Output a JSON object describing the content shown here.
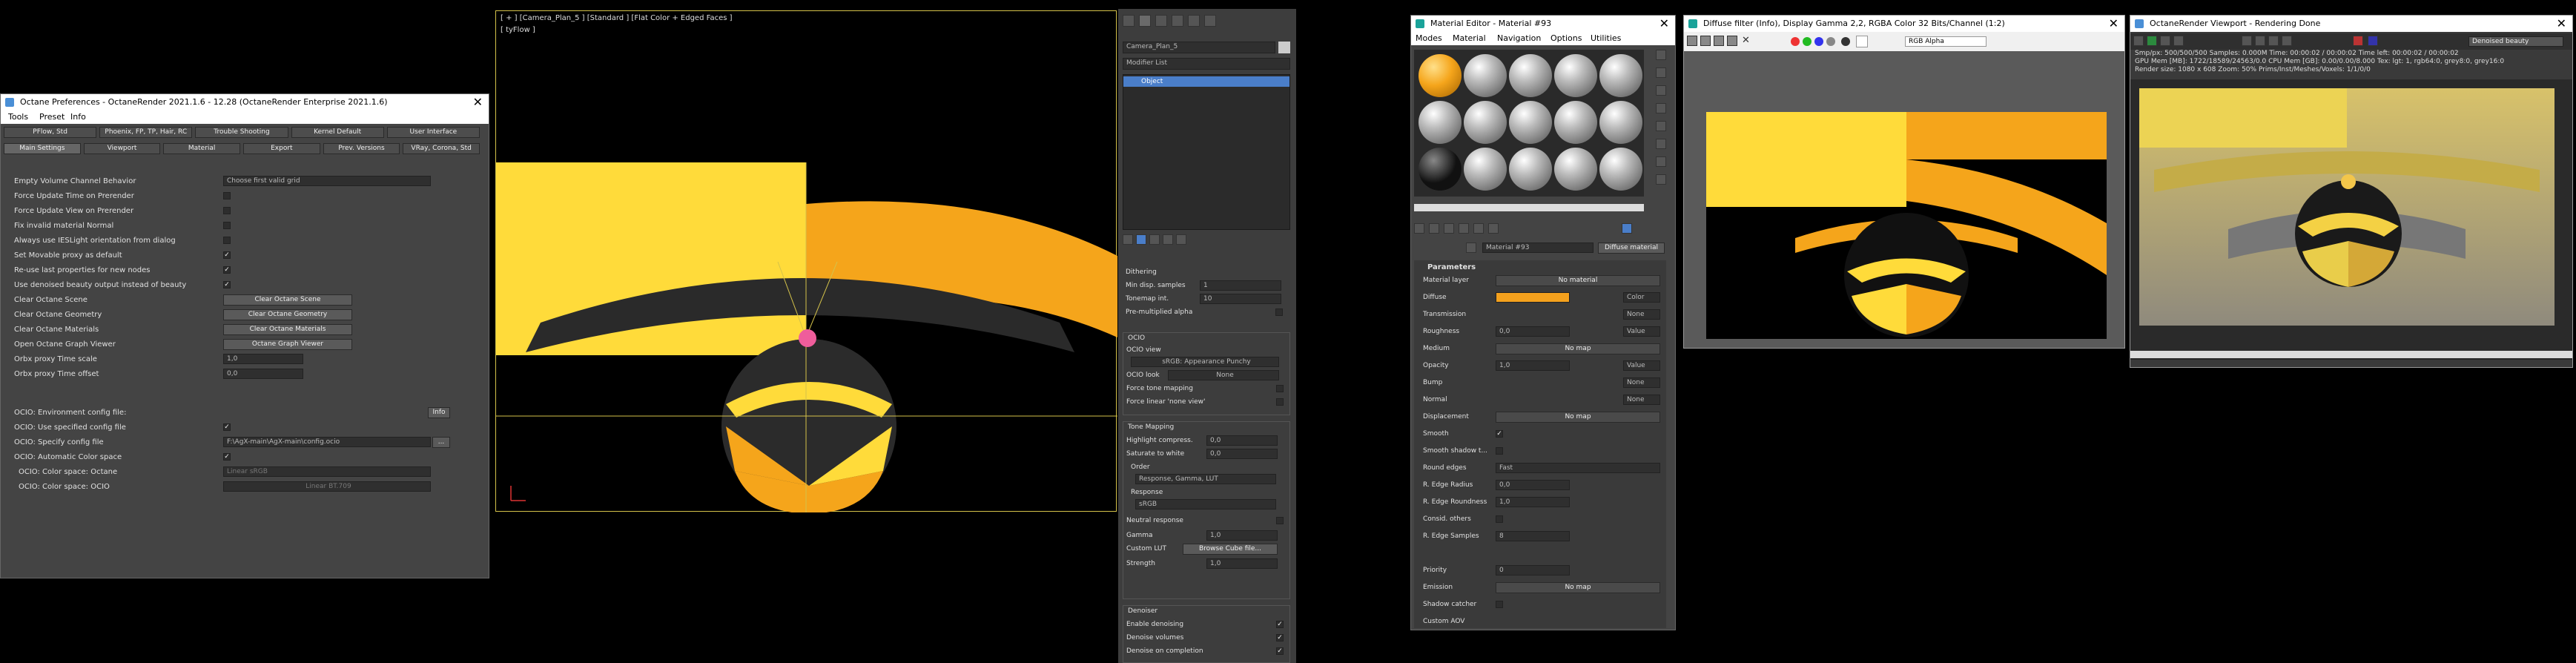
{
  "prefs": {
    "title": "Octane Preferences - OctaneRender 2021.1.6 - 12.28 (OctaneRender Enterprise 2021.1.6)",
    "menu": [
      "Tools",
      "Preset",
      "Info"
    ],
    "tabs_row1": [
      "PFlow, Std",
      "Phoenix, FP, TP, Hair, RC",
      "Trouble Shooting",
      "Kernel Default",
      "User Interface"
    ],
    "tabs_row2": [
      "Main Settings",
      "Viewport",
      "Material",
      "Export",
      "Prev. Versions",
      "VRay, Corona, Std"
    ],
    "rows": [
      {
        "label": "Empty Volume Channel Behavior",
        "kind": "select",
        "value": "Choose first valid grid"
      },
      {
        "label": "Force Update Time on Prerender",
        "kind": "check",
        "value": ""
      },
      {
        "label": "Force Update View on Prerender",
        "kind": "check",
        "value": ""
      },
      {
        "label": "Fix invalid material Normal",
        "kind": "check",
        "value": ""
      },
      {
        "label": "Always use IESLight orientation from dialog",
        "kind": "check",
        "value": ""
      },
      {
        "label": "Set Movable proxy as default",
        "kind": "check",
        "value": "✓"
      },
      {
        "label": "Re-use last properties for new nodes",
        "kind": "check",
        "value": "✓"
      },
      {
        "label": "Use denoised beauty output instead of beauty",
        "kind": "check",
        "value": "✓"
      },
      {
        "label": "Clear Octane Scene",
        "kind": "button",
        "value": "Clear Octane Scene"
      },
      {
        "label": "Clear Octane Geometry",
        "kind": "button",
        "value": "Clear Octane Geometry"
      },
      {
        "label": "Clear Octane Materials",
        "kind": "button",
        "value": "Clear Octane Materials"
      },
      {
        "label": "Open Octane Graph Viewer",
        "kind": "button",
        "value": "Octane Graph Viewer"
      },
      {
        "label": "Orbx proxy Time scale",
        "kind": "spin",
        "value": "1,0"
      },
      {
        "label": "Orbx proxy Time offset",
        "kind": "spin",
        "value": "0,0"
      }
    ],
    "ocio_env_label": "OCIO: Environment config file:",
    "ocio_env_button": "Info",
    "ocio_use_label": "OCIO: Use specified config file",
    "ocio_spec_label": "OCIO: Specify config file",
    "ocio_spec_value": "F:\\AgX-main\\AgX-main\\config.ocio",
    "ocio_spec_browse": "...",
    "ocio_auto_label": "OCIO: Automatic Color space",
    "ocio_cs_octane_label": "OCIO: Color space: Octane",
    "ocio_cs_octane_value": "Linear sRGB",
    "ocio_cs_ocio_label": "OCIO: Color space: OCIO",
    "ocio_cs_ocio_value": "Linear BT.709"
  },
  "viewport": {
    "label": "[ + ] [Camera_Plan_5 ] [Standard ] [Flat Color + Edged Faces ]",
    "sublabel": "[ tyFlow ]"
  },
  "cmd": {
    "object_name": "Camera_Plan_5",
    "modifier_list": "Modifier List",
    "stack_item": "Object",
    "rows": [
      {
        "label": "Dithering",
        "kind": "none",
        "value": ""
      },
      {
        "label": "Min disp. samples",
        "kind": "spin",
        "value": "1"
      },
      {
        "label": "Tonemap int.",
        "kind": "spin",
        "value": "10"
      },
      {
        "label": "Pre-multiplied alpha",
        "kind": "check",
        "value": ""
      }
    ],
    "ocio_header": "OCIO",
    "ocio_view_label": "OCIO view",
    "ocio_view_value": "sRGB: Appearance Punchy",
    "ocio_look_label": "OCIO look",
    "ocio_look_value": "None",
    "force_tone_label": "Force tone mapping",
    "force_linear_label": "Force linear 'none view'",
    "tm_header": "Tone Mapping",
    "tm_rows": [
      {
        "label": "Highlight compress.",
        "value": "0,0"
      },
      {
        "label": "Saturate to white",
        "value": "0,0"
      }
    ],
    "order_label": "Order",
    "order_value": "Response, Gamma, LUT",
    "response_label": "Response",
    "response_value": "sRGB",
    "neutral_label": "Neutral response",
    "gamma_label": "Gamma",
    "gamma_value": "1,0",
    "lut_label": "Custom LUT",
    "lut_button": "Browse Cube file...",
    "strength_label": "Strength",
    "strength_value": "1,0",
    "denoiser_header": "Denoiser",
    "denoise_rows": [
      {
        "label": "Enable denoising",
        "value": "✓"
      },
      {
        "label": "Denoise volumes",
        "value": "✓"
      },
      {
        "label": "Denoise on completion",
        "value": "✓"
      }
    ]
  },
  "mated": {
    "title": "Material Editor - Material #93",
    "menu": [
      "Modes",
      "Material",
      "Navigation",
      "Options",
      "Utilities"
    ],
    "mat_name": "Material #93",
    "mat_type": "Diffuse material",
    "rollout": "Parameters",
    "params": [
      {
        "label": "Material layer",
        "kind": "wide",
        "value": "No material"
      },
      {
        "label": "Diffuse",
        "kind": "color",
        "value": "Color"
      },
      {
        "label": "Transmission",
        "kind": "dd",
        "value": "None"
      },
      {
        "label": "Roughness",
        "kind": "spindd",
        "value": "0,0",
        "extra": "Value"
      },
      {
        "label": "Medium",
        "kind": "wide",
        "value": "No map"
      },
      {
        "label": "Opacity",
        "kind": "spindd",
        "value": "1,0",
        "extra": "Value"
      },
      {
        "label": "Bump",
        "kind": "dd",
        "value": "None"
      },
      {
        "label": "Normal",
        "kind": "dd",
        "value": "None"
      },
      {
        "label": "Displacement",
        "kind": "wide",
        "value": "No map"
      },
      {
        "label": "Smooth",
        "kind": "check",
        "value": "✓"
      },
      {
        "label": "Smooth shadow t...",
        "kind": "check",
        "value": ""
      },
      {
        "label": "Round edges",
        "kind": "select",
        "value": "Fast"
      },
      {
        "label": "R. Edge Radius",
        "kind": "spin",
        "value": "0,0"
      },
      {
        "label": "R. Edge Roundness",
        "kind": "spin",
        "value": "1,0"
      },
      {
        "label": "Consid. others",
        "kind": "check",
        "value": ""
      },
      {
        "label": "R. Edge Samples",
        "kind": "spin",
        "value": "8"
      },
      {
        "label": "",
        "kind": "none",
        "value": ""
      },
      {
        "label": "Priority",
        "kind": "spin",
        "value": "0"
      },
      {
        "label": "Emission",
        "kind": "wide",
        "value": "No map"
      },
      {
        "label": "Shadow catcher",
        "kind": "check",
        "value": ""
      },
      {
        "label": "Custom AOV",
        "kind": "none",
        "value": ""
      }
    ],
    "diffuse_color": "#f4a11d"
  },
  "vfb": {
    "title": "Diffuse filter (Info), Display Gamma 2,2, RGBA Color 32 Bits/Channel (1:2)",
    "channel": "RGB Alpha"
  },
  "ov": {
    "title": "OctaneRender Viewport - Rendering Done",
    "pass": "Denoised beauty",
    "status": [
      "Smp/px: 500/500/500    Samples: 0.000M    Time: 00:00:02 / 00:00:02    Time left: 00:00:02 / 00:00:02",
      "GPU Mem [MB]: 1722/18589/24563/0.0    CPU Mem [GB]: 0.00/0.00/8.000    Tex: lgt: 1, rgb64:0, grey8:0, grey16:0",
      "Render size: 1080 x 608    Zoom: 50%    Prims/Inst/Meshes/Voxels: 1/1/0/0"
    ]
  },
  "colors": {
    "yellow": "#ffdb3a",
    "orange": "#f5a51b",
    "pink": "#ef5d9b"
  }
}
